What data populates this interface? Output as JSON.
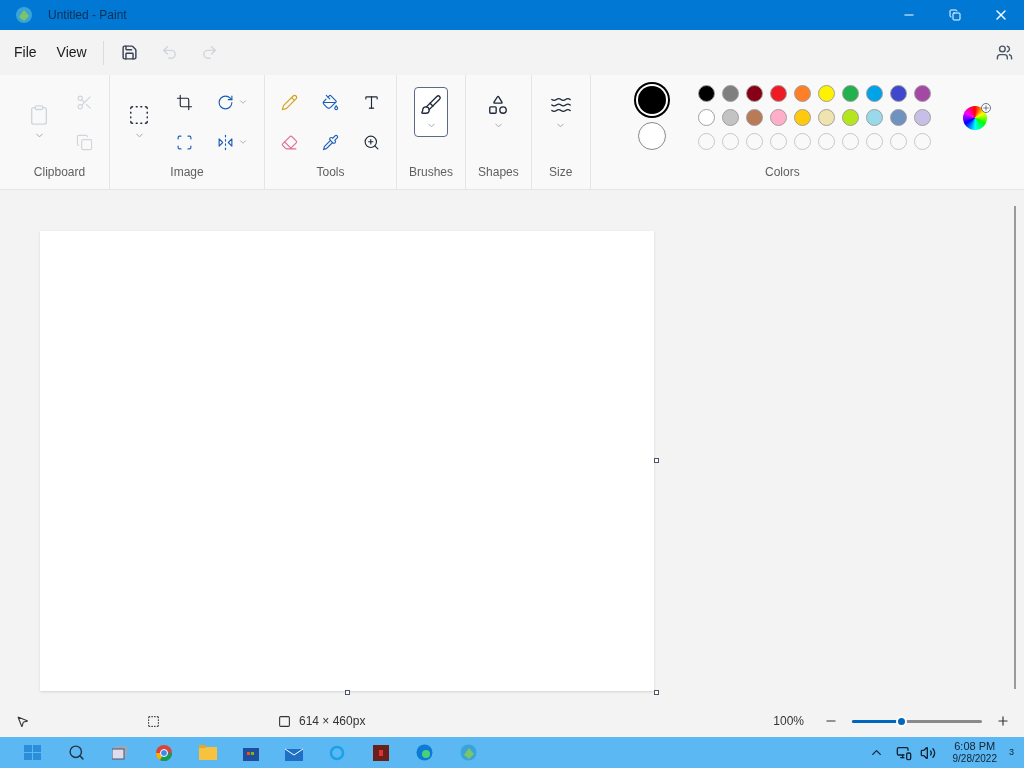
{
  "window": {
    "title": "Untitled - Paint"
  },
  "menu": [
    {
      "label": "File"
    },
    {
      "label": "View"
    }
  ],
  "quick_actions": [
    {
      "kind": "save",
      "disabled": false
    },
    {
      "kind": "undo",
      "disabled": true
    },
    {
      "kind": "redo",
      "disabled": true
    }
  ],
  "ribbon": [
    {
      "label": "Clipboard",
      "tools": [
        {
          "kind": "paste",
          "disabled": true,
          "dropdown": true,
          "large": true
        },
        {
          "kind": "cut",
          "disabled": true,
          "dropdown": false,
          "large": false
        },
        {
          "kind": "copy",
          "disabled": true,
          "dropdown": false,
          "large": false
        }
      ]
    },
    {
      "label": "Image",
      "tools": [
        {
          "kind": "select",
          "disabled": false,
          "dropdown": true,
          "large": true
        },
        {
          "kind": "crop",
          "disabled": false,
          "dropdown": false,
          "large": false
        },
        {
          "kind": "resize",
          "disabled": false,
          "dropdown": false,
          "large": false
        },
        {
          "kind": "rotate",
          "disabled": false,
          "dropdown": true,
          "large": false
        },
        {
          "kind": "flip",
          "disabled": false,
          "dropdown": true,
          "large": false
        }
      ]
    },
    {
      "label": "Tools",
      "tools": [
        {
          "kind": "pencil",
          "disabled": false,
          "dropdown": false,
          "large": false
        },
        {
          "kind": "eraser",
          "disabled": false,
          "dropdown": false,
          "large": false
        },
        {
          "kind": "fill",
          "disabled": false,
          "dropdown": false,
          "large": false
        },
        {
          "kind": "picker",
          "disabled": false,
          "dropdown": false,
          "large": false
        },
        {
          "kind": "text",
          "disabled": false,
          "dropdown": false,
          "large": false
        },
        {
          "kind": "magnifier",
          "disabled": false,
          "dropdown": false,
          "large": false
        }
      ]
    },
    {
      "label": "Brushes",
      "tools": [
        {
          "kind": "brush",
          "disabled": false,
          "dropdown": true,
          "large": true,
          "selected": true
        }
      ]
    },
    {
      "label": "Shapes",
      "tools": [
        {
          "kind": "shapes",
          "disabled": false,
          "dropdown": true,
          "large": true,
          "selected": false
        }
      ]
    },
    {
      "label": "Size",
      "tools": [
        {
          "kind": "size",
          "disabled": false,
          "dropdown": true,
          "large": true,
          "selected": false
        }
      ]
    }
  ],
  "colors": {
    "label": "Colors",
    "current": [
      {
        "color": "#000000",
        "selected": true
      },
      {
        "color": "#ffffff",
        "selected": false
      }
    ],
    "palette": [
      [
        {
          "color": "#000000"
        },
        {
          "color": "#7f7f7f"
        },
        {
          "color": "#880015"
        },
        {
          "color": "#ed1c24"
        },
        {
          "color": "#ff7f27"
        },
        {
          "color": "#fff200"
        },
        {
          "color": "#22b14c"
        },
        {
          "color": "#00a2e8"
        },
        {
          "color": "#3f48cc"
        },
        {
          "color": "#a349a4"
        }
      ],
      [
        {
          "color": "#ffffff"
        },
        {
          "color": "#c3c3c3"
        },
        {
          "color": "#b97a57"
        },
        {
          "color": "#ffaec9"
        },
        {
          "color": "#ffc90e"
        },
        {
          "color": "#efe4b0"
        },
        {
          "color": "#b5e61d"
        },
        {
          "color": "#99d9ea"
        },
        {
          "color": "#7092be"
        },
        {
          "color": "#c8bfe7"
        }
      ],
      [
        {
          "kind": "empty"
        },
        {
          "kind": "empty"
        },
        {
          "kind": "empty"
        },
        {
          "kind": "empty"
        },
        {
          "kind": "empty"
        },
        {
          "kind": "empty"
        },
        {
          "kind": "empty"
        },
        {
          "kind": "empty"
        },
        {
          "kind": "empty"
        },
        {
          "kind": "empty"
        }
      ]
    ]
  },
  "status_bar": {
    "canvas_size": "614 × 460px",
    "zoom": "100%",
    "zoom_slider": {
      "level": 0.38
    }
  },
  "taskbar": {
    "time": "6:08 PM",
    "date": "9/28/2022",
    "notification_count": "3"
  }
}
